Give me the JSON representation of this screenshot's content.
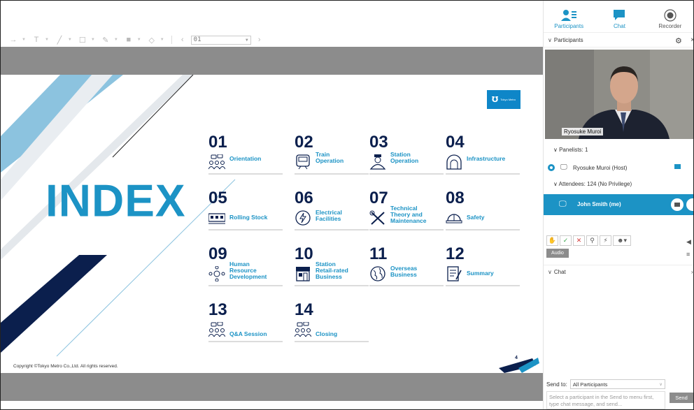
{
  "toolbar": {
    "page_value": "01"
  },
  "slide": {
    "title": "INDEX",
    "logo_text": "Tokyo Metro",
    "copyright": "Copyright ©Tokyo Metro Co.,Ltd. All rights reserved.",
    "page_number": "4",
    "items": [
      {
        "num": "01",
        "label": "Orientation",
        "icon": "people-chat-icon"
      },
      {
        "num": "02",
        "label": "Train\nOperation",
        "icon": "train-icon"
      },
      {
        "num": "03",
        "label": "Station\nOperation",
        "icon": "station-staff-icon"
      },
      {
        "num": "04",
        "label": "Infrastructure",
        "icon": "tunnel-icon"
      },
      {
        "num": "05",
        "label": "Rolling Stock",
        "icon": "railcar-icon"
      },
      {
        "num": "06",
        "label": "Electrical\nFacilities",
        "icon": "lightning-icon"
      },
      {
        "num": "07",
        "label": "Technical\nTheory and\nMaintenance",
        "icon": "tools-icon"
      },
      {
        "num": "08",
        "label": "Safety",
        "icon": "helmet-icon"
      },
      {
        "num": "09",
        "label": "Human\nResource\nDevelopment",
        "icon": "people-network-icon"
      },
      {
        "num": "10",
        "label": "Station\nRetail-rated\nBusiness",
        "icon": "shop-icon"
      },
      {
        "num": "11",
        "label": "Overseas\nBusiness",
        "icon": "globe-icon"
      },
      {
        "num": "12",
        "label": "Summary",
        "icon": "document-icon"
      },
      {
        "num": "13",
        "label": "Q&A Session",
        "icon": "people-chat-icon"
      },
      {
        "num": "14",
        "label": "Closing",
        "icon": "people-chat-icon"
      }
    ]
  },
  "side": {
    "tabs": [
      {
        "label": "Participants",
        "icon": "participants-icon"
      },
      {
        "label": "Chat",
        "icon": "chat-icon"
      },
      {
        "label": "Recorder",
        "icon": "record-icon"
      }
    ],
    "participants_header": "Participants",
    "video_name": "Ryosuke Muroi",
    "panelists_label": "Panelists: 1",
    "host_name": "Ryosuke Muroi (Host)",
    "attendees_label": "Attendees: 124 (No Privilege)",
    "me_name": "John Smith (me)",
    "audio_label": "Audio",
    "chat_header": "Chat",
    "send_to_label": "Send to:",
    "send_to_value": "All Participants",
    "chat_placeholder": "Select a participant in the Send to menu first, type chat message, and send...",
    "send_label": "Send"
  },
  "colors": {
    "accent": "#1c93c5",
    "navy": "#0b1f4d",
    "band": "#8c8c8c"
  }
}
